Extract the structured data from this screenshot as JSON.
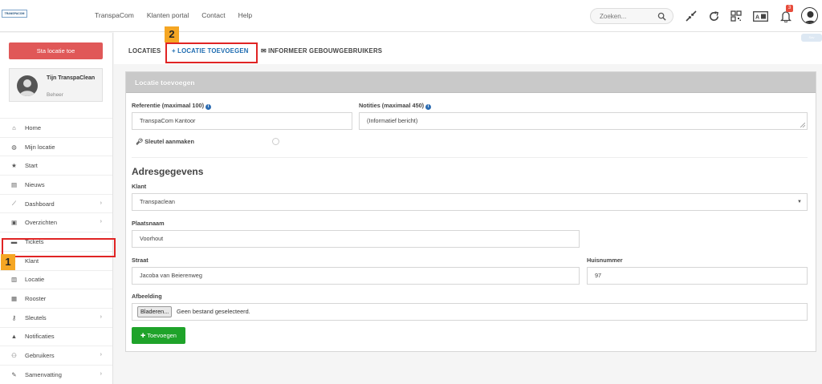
{
  "topbar": {
    "logo_text": "TRANSPACOM",
    "nav": [
      "TranspaCom",
      "Klanten portal",
      "Contact",
      "Help"
    ],
    "search_placeholder": "Zoeken...",
    "notification_count": "3",
    "icons": [
      "compress-icon",
      "refresh-icon",
      "qr-code-icon",
      "id-card-icon",
      "bell-icon",
      "user-avatar-icon"
    ]
  },
  "sidebar": {
    "primary_button": "Sta locatie toe",
    "user": {
      "name": "Tijn TranspaClean",
      "role": "Beheer"
    },
    "items": [
      {
        "label": "Home",
        "icon": "home-icon",
        "chevron": false
      },
      {
        "label": "Mijn locatie",
        "icon": "globe-icon",
        "chevron": false
      },
      {
        "label": "Start",
        "icon": "star-icon",
        "chevron": false
      },
      {
        "label": "Nieuws",
        "icon": "newspaper-icon",
        "chevron": false
      },
      {
        "label": "Dashboard",
        "icon": "chart-icon",
        "chevron": true
      },
      {
        "label": "Overzichten",
        "icon": "file-icon",
        "chevron": true
      },
      {
        "label": "Tickets",
        "icon": "comment-icon",
        "chevron": false
      },
      {
        "label": "Klant",
        "icon": "user-icon",
        "chevron": false
      },
      {
        "label": "Locatie",
        "icon": "building-icon",
        "chevron": false
      },
      {
        "label": "Rooster",
        "icon": "calendar-icon",
        "chevron": false
      },
      {
        "label": "Sleutels",
        "icon": "key-icon",
        "chevron": true
      },
      {
        "label": "Notificaties",
        "icon": "bell-icon",
        "chevron": false
      },
      {
        "label": "Gebruikers",
        "icon": "users-icon",
        "chevron": true
      },
      {
        "label": "Samenvatting",
        "icon": "edit-icon",
        "chevron": true
      }
    ]
  },
  "callouts": {
    "one": "1",
    "two": "2"
  },
  "tabs": {
    "locaties": "LOCATIES",
    "toevoegen": "LOCATIE TOEVOEGEN",
    "informeer": "INFORMEER GEBOUWGEBRUIKERS"
  },
  "panel": {
    "title": "Locatie toevoegen",
    "referentie_label": "Referentie (maximaal 100)",
    "referentie_value": "TranspaCom Kantoor",
    "notities_label": "Notities (maximaal 450)",
    "notities_value": "(Informatief bericht)",
    "sleutel_label": "Sleutel aanmaken",
    "section_title": "Adresgegevens",
    "klant_label": "Klant",
    "klant_value": "Transpaclean",
    "plaatsnaam_label": "Plaatsnaam",
    "plaatsnaam_value": "Voorhout",
    "straat_label": "Straat",
    "straat_value": "Jacoba van Beierenweg",
    "huisnummer_label": "Huisnummer",
    "huisnummer_value": "97",
    "afbeelding_label": "Afbeelding",
    "file_button": "Bladeren...",
    "file_status": "Geen bestand geselecteerd.",
    "submit": "Toevoegen"
  },
  "colors": {
    "accent": "#1c6bb0",
    "danger": "#e05858",
    "success": "#1fa32a",
    "highlight": "#e02424",
    "callout": "#f5a623"
  }
}
